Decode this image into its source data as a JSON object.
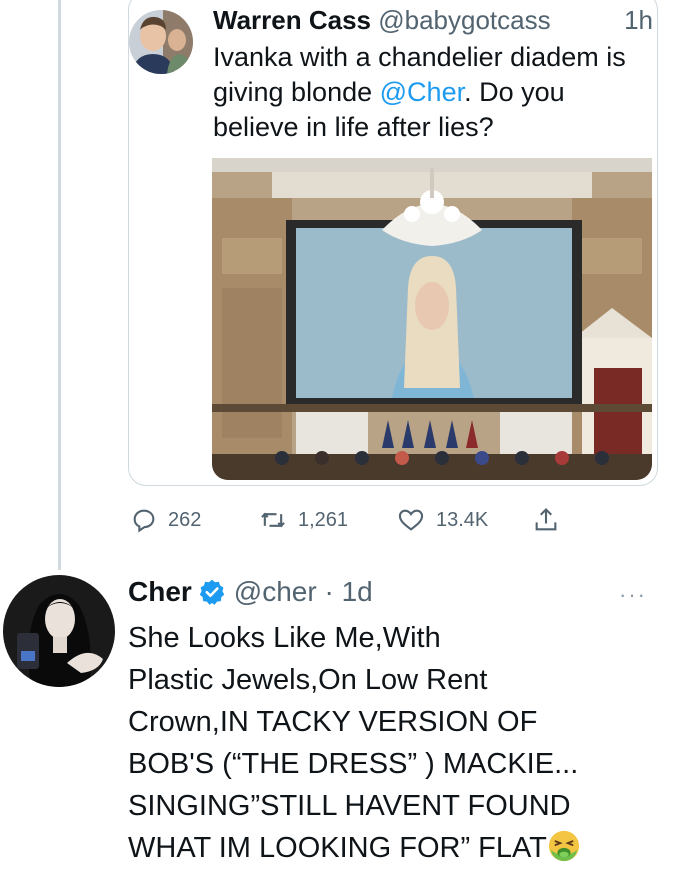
{
  "quoted_tweet": {
    "author_name": "Warren Cass",
    "handle": "@babygotcass",
    "time": "1h",
    "text_before": "Ivanka with a chandelier diadem is giving blonde ",
    "mention": "@Cher",
    "text_after": ". Do you believe in life after lies?"
  },
  "actions": {
    "replies": "262",
    "retweets": "1,261",
    "likes": "13.4K"
  },
  "reply": {
    "author_name": "Cher",
    "handle": "@cher · 1d",
    "more": "···",
    "text": "She Looks Like Me,With\nPlastic Jewels,On Low Rent\nCrown,IN TACKY VERSION OF\nBOB'S (“THE DRESS” ) MACKIE...\nSINGING”STILL HAVENT FOUND\nWHAT IM LOOKING FOR” FLAT"
  },
  "colors": {
    "link": "#1d9bf0",
    "verified": "#1d9bf0",
    "secondary_text": "#536471",
    "border": "#cfd9de"
  },
  "icons": [
    "reply-icon",
    "retweet-icon",
    "like-icon",
    "share-icon",
    "verified-badge-icon",
    "nauseated-face-icon"
  ]
}
